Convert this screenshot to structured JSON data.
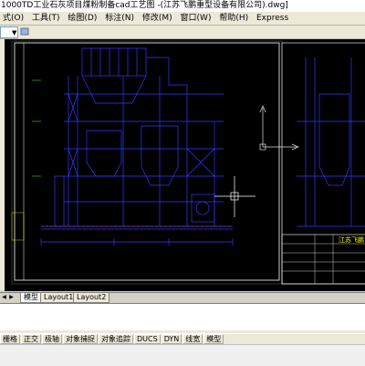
{
  "window": {
    "title": "1000TD工业石灰项目煤粉制备cad工艺图 -(江苏飞鹏重型设备有限公司).dwg]"
  },
  "menu": {
    "items": [
      "式(O)",
      "工具(T)",
      "绘图(D)",
      "标注(N)",
      "修改(M)",
      "窗口(W)",
      "帮助(H)",
      "Express"
    ]
  },
  "drawing": {
    "titleblock_company": "江苏飞鹏"
  },
  "layout_tabs": {
    "tabs": [
      "模型",
      "Layout1",
      "Layout2"
    ],
    "active": "模型"
  },
  "status": {
    "buttons": [
      "栅格",
      "正交",
      "极轴",
      "对象捕捉",
      "对象追踪",
      "DUCS",
      "DYN",
      "线宽",
      "模型"
    ]
  },
  "colors": {
    "canvas": "#000000",
    "drawing_primary": "#2f3bff",
    "drawing_frame": "#ffffff",
    "ucs": "#e0e0e0",
    "titleblock_text": "#ffff00"
  }
}
